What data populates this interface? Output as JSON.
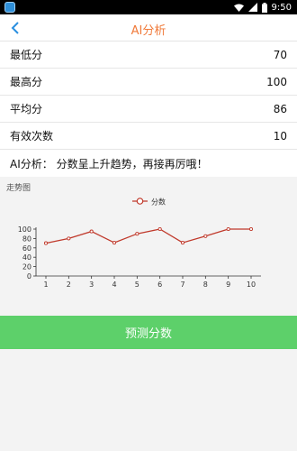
{
  "status_bar": {
    "time": "9:50"
  },
  "header": {
    "title": "AI分析",
    "back_icon": "chevron-left-icon"
  },
  "stats": [
    {
      "label": "最低分",
      "value": "70"
    },
    {
      "label": "最高分",
      "value": "100"
    },
    {
      "label": "平均分",
      "value": "86"
    },
    {
      "label": "有效次数",
      "value": "10"
    }
  ],
  "analysis": {
    "text": "AI分析： 分数呈上升趋势，再接再厉哦！"
  },
  "chart_section": {
    "title": "走势图"
  },
  "chart_data": {
    "type": "line",
    "x": [
      1,
      2,
      3,
      4,
      5,
      6,
      7,
      8,
      9,
      10
    ],
    "series": [
      {
        "name": "分数",
        "values": [
          70,
          80,
          95,
          71,
          90,
          100,
          71,
          85,
          100,
          100
        ],
        "color": "#c0392b"
      }
    ],
    "ylim": [
      0,
      100
    ],
    "y_ticks": [
      0,
      20,
      40,
      60,
      80,
      100
    ],
    "legend": "top-center",
    "grid": false
  },
  "actions": {
    "predict_label": "预测分数"
  },
  "colors": {
    "accent": "#f07a3a",
    "button": "#5dd06a",
    "line": "#c0392b"
  }
}
